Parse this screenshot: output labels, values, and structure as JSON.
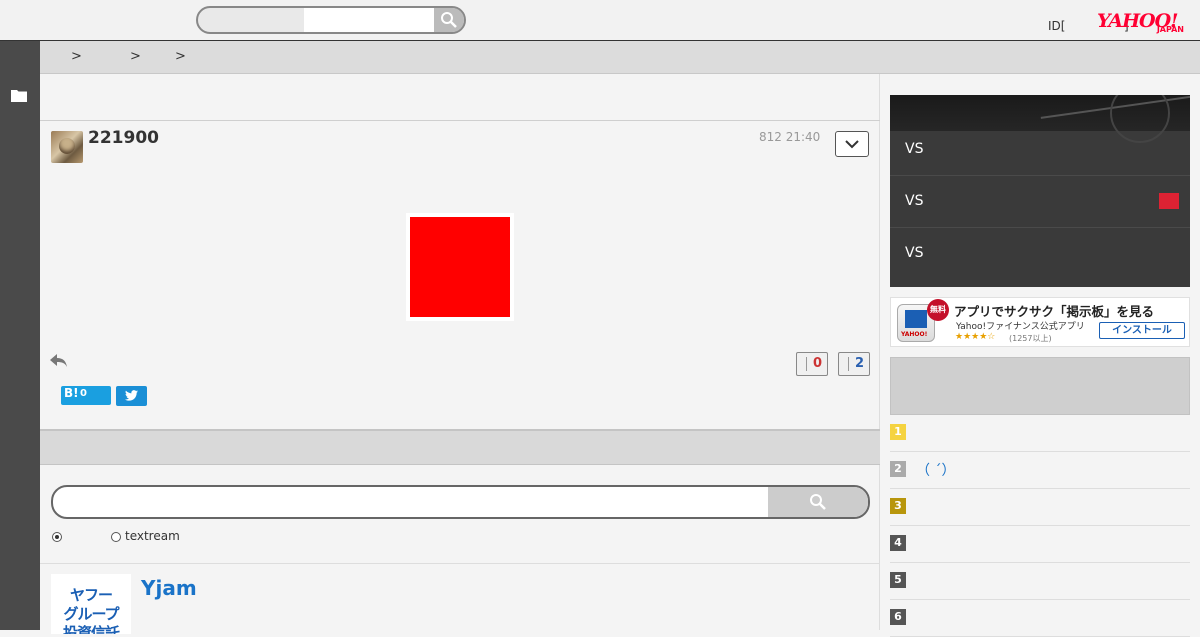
{
  "header": {
    "search_placeholder": "",
    "id_text": "ID[",
    "id_close": "]",
    "logo_text": "YAHOO!",
    "logo_sub": "JAPAN"
  },
  "breadcrumb": {
    "separators": [
      ">",
      ">",
      ">"
    ]
  },
  "post": {
    "poster": "221900",
    "date": "812 21:40",
    "votes": {
      "up": "0",
      "down": "2"
    },
    "hatena_label": "B!",
    "hatena_count": "0"
  },
  "search": {
    "radio_options": [
      "",
      "textream"
    ],
    "selected": 0
  },
  "promo": {
    "logo_lines": [
      "ヤフー",
      "グループ",
      "投資信託"
    ],
    "title": "Yjam"
  },
  "baseball": {
    "matches": [
      {
        "label": "VS"
      },
      {
        "label": "VS"
      },
      {
        "label": "VS"
      }
    ]
  },
  "app_banner": {
    "badge": "無料",
    "title": "アプリでサクサク「掲示板」を見る",
    "subtitle": "Yahoo!ファイナンス公式アプリ",
    "stars": "★★★★☆",
    "count": "(1257以上)",
    "install": "インストール",
    "icon_label": "YAHOO!"
  },
  "ranking": {
    "items": [
      {
        "num": "1",
        "text": "",
        "color": "#f5d340"
      },
      {
        "num": "2",
        "text": "（ ´）",
        "color": "#aaaaaa"
      },
      {
        "num": "3",
        "text": "",
        "color": "#b8960c"
      },
      {
        "num": "4",
        "text": "",
        "color": "#555555"
      },
      {
        "num": "5",
        "text": "",
        "color": "#555555"
      },
      {
        "num": "6",
        "text": "",
        "color": "#555555"
      }
    ]
  },
  "colors": {
    "accent_link": "#1a73c8",
    "brand": "#ff0033",
    "image_fill": "#ff0000"
  }
}
